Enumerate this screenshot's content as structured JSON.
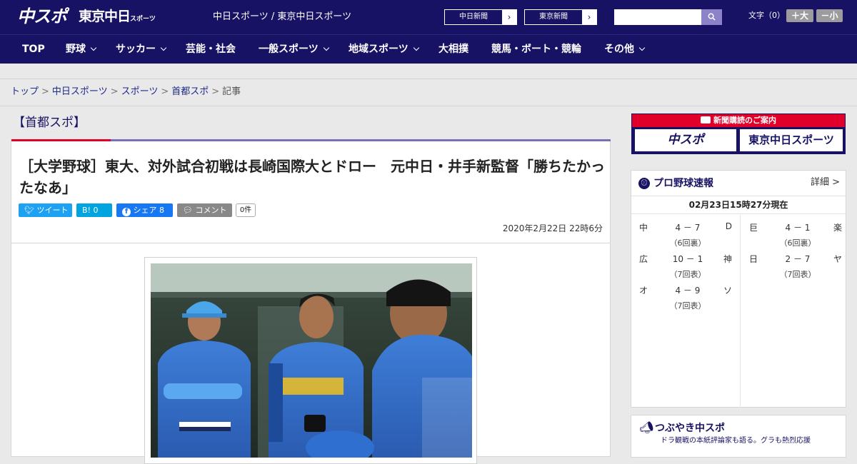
{
  "header": {
    "logo_chuspo": "中スポ",
    "logo_tokyo": "東京中日",
    "logo_tokyo_small": "スポーツ",
    "site_title": "中日スポーツ / 東京中日スポーツ",
    "ext_links": [
      {
        "label": "中日新聞"
      },
      {
        "label": "東京新聞"
      }
    ],
    "search_placeholder": "",
    "font_size_label": "文字（0）",
    "font_plus_label": "＋大",
    "font_minus_label": "－小"
  },
  "nav": {
    "items": [
      {
        "label": "TOP",
        "has_dropdown": false
      },
      {
        "label": "野球",
        "has_dropdown": true
      },
      {
        "label": "サッカー",
        "has_dropdown": true
      },
      {
        "label": "芸能・社会",
        "has_dropdown": false
      },
      {
        "label": "一般スポーツ",
        "has_dropdown": true
      },
      {
        "label": "地域スポーツ",
        "has_dropdown": true
      },
      {
        "label": "大相撲",
        "has_dropdown": false
      },
      {
        "label": "競馬・ボート・競輪",
        "has_dropdown": false
      },
      {
        "label": "その他",
        "has_dropdown": true
      }
    ]
  },
  "breadcrumb": {
    "items": [
      "トップ",
      "中日スポーツ",
      "スポーツ",
      "首都スポ"
    ],
    "current": "記事"
  },
  "article": {
    "section": "【首都スポ】",
    "title": "［大学野球］東大、対外試合初戦は長崎国際大とドロー　元中日・井手新監督「勝ちたかったなあ」",
    "share": {
      "tweet": "ツイート",
      "hatena": "B! 0",
      "facebook": "シェア 8",
      "comment": "コメント",
      "comment_count": "0件"
    },
    "date": "2020年2月22日 22時6分"
  },
  "sidebar": {
    "ad": {
      "top": "新聞購読のご案内",
      "left": "中スポ",
      "right": "東京中日スポーツ"
    },
    "scores": {
      "title": "プロ野球速報",
      "detail": "詳細 >",
      "time": "02月23日15時27分現在",
      "games": [
        {
          "home": "中",
          "score": "4 － 7",
          "away": "D",
          "inning": "（6回裏）"
        },
        {
          "home": "巨",
          "score": "4 － 1",
          "away": "楽",
          "inning": "（6回裏）"
        },
        {
          "home": "広",
          "score": "10 － 1",
          "away": "神",
          "inning": "（7回表）"
        },
        {
          "home": "日",
          "score": "2 － 7",
          "away": "ヤ",
          "inning": "（7回表）"
        },
        {
          "home": "オ",
          "score": "4 － 9",
          "away": "ソ",
          "inning": "（7回表）"
        }
      ]
    },
    "tweet": {
      "title": "つぶやき中スポ",
      "sub": "ドラ観戦の本紙評論家も語る。グラも熱烈応援"
    }
  },
  "colors": {
    "brand_navy": "#171263",
    "accent_red": "#e1002a",
    "accent_purple": "#7a70b6"
  }
}
